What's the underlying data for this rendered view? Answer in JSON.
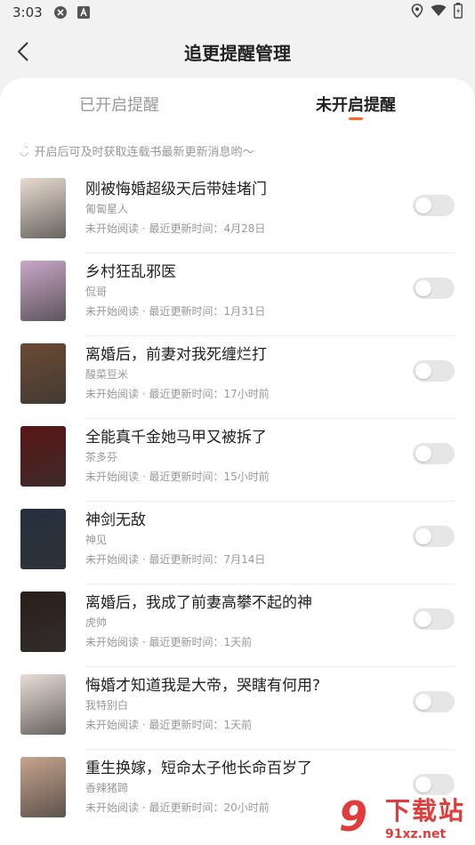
{
  "status_bar": {
    "time": "3:03",
    "icons": [
      "location-icon",
      "wifi-icon",
      "battery-icon"
    ]
  },
  "header": {
    "title": "追更提醒管理",
    "back_icon": "chevron-left-icon"
  },
  "tabs": {
    "enabled_label": "已开启提醒",
    "disabled_label": "未开启提醒",
    "active_color": "#ff6a1a"
  },
  "hint": "开启后可及时获取连载书最新更新消息哟～",
  "books": [
    {
      "title": "刚被悔婚超级天后带娃堵门",
      "author": "匍匐星人",
      "status": "未开始阅读 · 最近更新时间：4月28日",
      "cover_color": "#e9dcd0",
      "toggle_on": false
    },
    {
      "title": "乡村狂乱邪医",
      "author": "侃哥",
      "status": "未开始阅读 · 最近更新时间：1月31日",
      "cover_color": "#c9a7c7",
      "toggle_on": false
    },
    {
      "title": "离婚后，前妻对我死缠烂打",
      "author": "酸菜豆米",
      "status": "未开始阅读 · 最近更新时间：17小时前",
      "cover_color": "#6b4a33",
      "toggle_on": false
    },
    {
      "title": "全能真千金她马甲又被拆了",
      "author": "茶多芬",
      "status": "未开始阅读 · 最近更新时间：15小时前",
      "cover_color": "#5a1414",
      "toggle_on": false
    },
    {
      "title": "神剑无敌",
      "author": "神见",
      "status": "未开始阅读 · 最近更新时间：7月14日",
      "cover_color": "#24303f",
      "toggle_on": false
    },
    {
      "title": "离婚后，我成了前妻高攀不起的神",
      "author": "虎帅",
      "status": "未开始阅读 · 最近更新时间：1天前",
      "cover_color": "#2a1e1a",
      "toggle_on": false
    },
    {
      "title": "悔婚才知道我是大帝，哭瞎有何用?",
      "author": "我特别白",
      "status": "未开始阅读 · 最近更新时间：1天前",
      "cover_color": "#e8ddd6",
      "toggle_on": false
    },
    {
      "title": "重生换嫁，短命太子他长命百岁了",
      "author": "香辣猪蹄",
      "status": "未开始阅读 · 最近更新时间：20小时前",
      "cover_color": "#c7a38d",
      "toggle_on": false
    }
  ],
  "watermark": {
    "logo": "9",
    "text": "下载站",
    "url": "91xz.net"
  }
}
